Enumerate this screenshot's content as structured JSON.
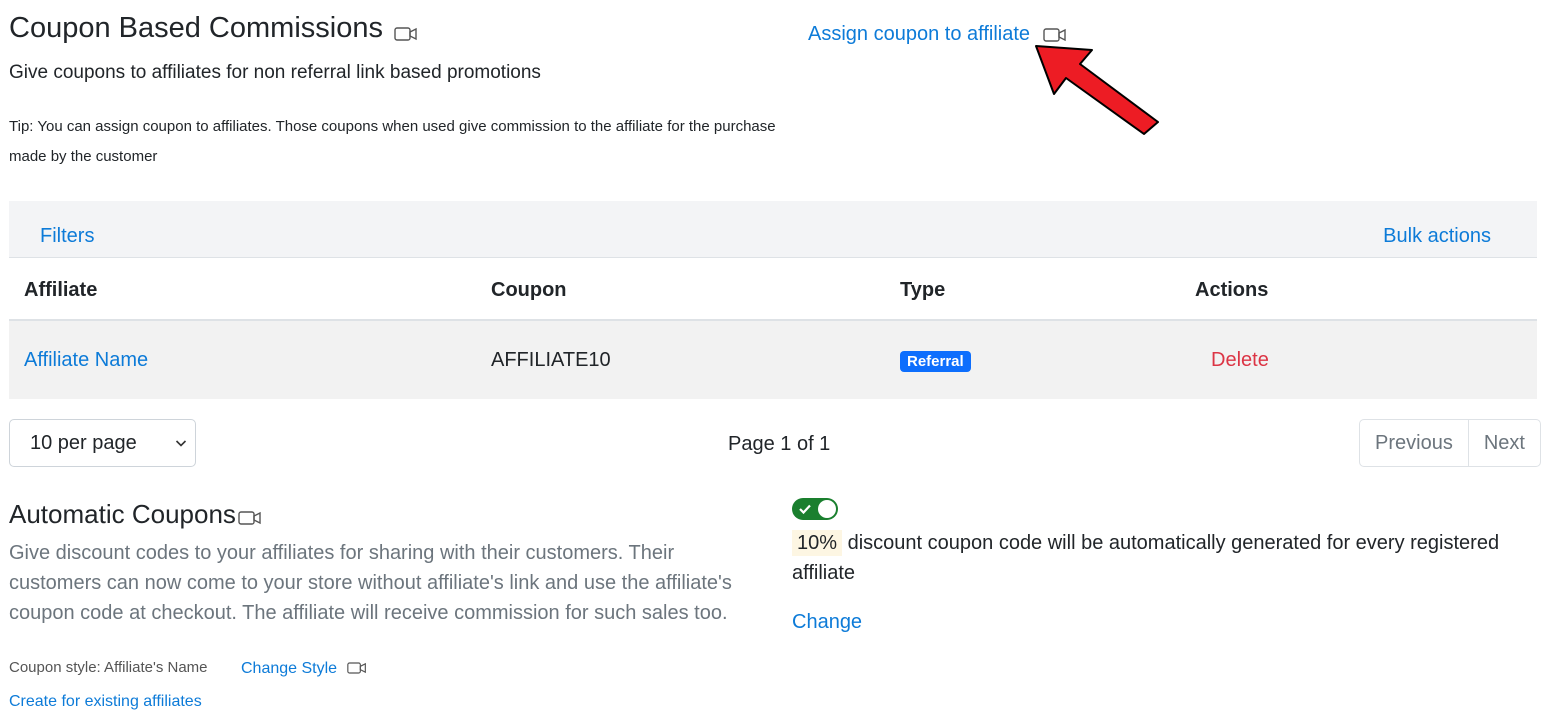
{
  "header": {
    "title": "Coupon Based Commissions",
    "subtitle": "Give coupons to affiliates for non referral link based promotions",
    "tip": "Tip: You can assign coupon to affiliates. Those coupons when used give commission to the affiliate for the purchase made by the customer",
    "assign_link": "Assign coupon to affiliate"
  },
  "toolbar": {
    "filters": "Filters",
    "bulk_actions": "Bulk actions"
  },
  "table": {
    "columns": [
      "Affiliate",
      "Coupon",
      "Type",
      "Actions"
    ],
    "rows": [
      {
        "affiliate": "Affiliate Name",
        "coupon": "AFFILIATE10",
        "type": "Referral",
        "action": "Delete"
      }
    ]
  },
  "pagination": {
    "per_page": "10 per page",
    "page_info": "Page 1 of 1",
    "previous": "Previous",
    "next": "Next"
  },
  "automatic": {
    "title": "Automatic Coupons",
    "description": "Give discount codes to your affiliates for sharing with their customers. Their customers can now come to your store without affiliate's link and use the affiliate's coupon code at checkout. The affiliate will receive commission for such sales too.",
    "coupon_style": "Coupon style: Affiliate's Name",
    "change_style": "Change Style",
    "create_existing": "Create for existing affiliates",
    "enabled": true,
    "discount_pct": "10%",
    "discount_text": "discount coupon code will be automatically generated for every registered affiliate",
    "change": "Change"
  },
  "colors": {
    "link": "#0d7bd8",
    "danger": "#dc3545",
    "badge": "#0d6efd",
    "toggle_on": "#1a7f2e",
    "arrow": "#ed1c24"
  },
  "icons": [
    "video-icon",
    "chevron-down-icon",
    "check-icon",
    "red-arrow"
  ]
}
